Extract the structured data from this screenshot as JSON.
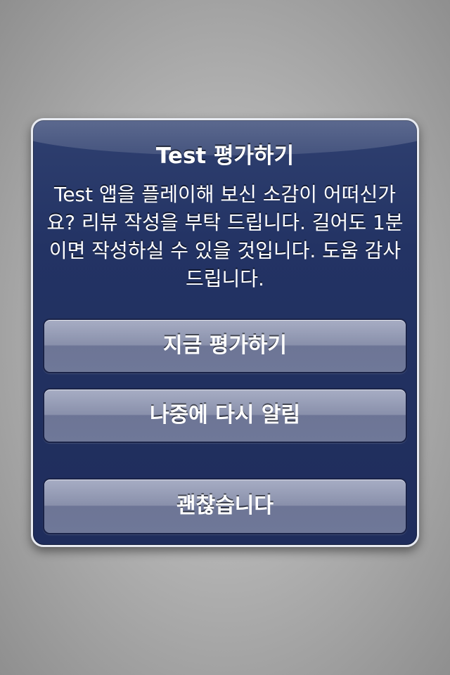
{
  "alert": {
    "title": "Test 평가하기",
    "message": "Test 앱을 플레이해 보신 소감이 어떠신가요? 리뷰 작성을 부탁 드립니다. 길어도 1분이면 작성하실 수 있을 것입니다. 도움 감사 드립니다.",
    "buttons": {
      "rate_now": "지금 평가하기",
      "remind_later": "나중에 다시 알림",
      "no_thanks": "괜찮습니다"
    }
  }
}
